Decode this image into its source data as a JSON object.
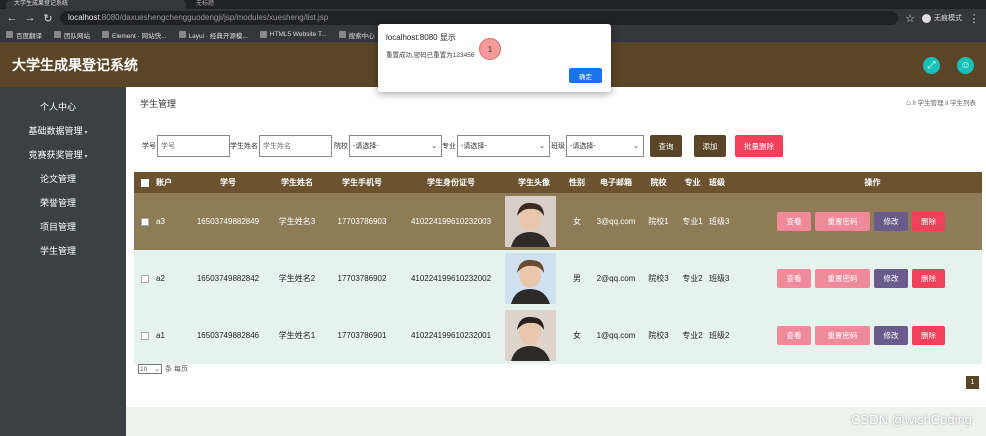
{
  "browser": {
    "tab_active": "大学生成果登记系统",
    "tab_inactive": "无标题",
    "url_host": "localhost",
    "url_rest": ":8080/daxueshengchengguodengji/jsp/modules/xuesheng/list.jsp",
    "incognito_label": "无痕模式",
    "bookmarks": [
      "百度翻译",
      "团队网站",
      "Element · 网站快...",
      "Layui · 经典开源模...",
      "HTML5 Website T...",
      "搜索中心"
    ]
  },
  "app": {
    "title": "大学生成果登记系统"
  },
  "sidebar": {
    "items": [
      {
        "label": "个人中心",
        "has_caret": false
      },
      {
        "label": "基础数据管理",
        "has_caret": true
      },
      {
        "label": "竞赛获奖管理",
        "has_caret": true
      },
      {
        "label": "论文管理",
        "has_caret": false
      },
      {
        "label": "荣誉管理",
        "has_caret": false
      },
      {
        "label": "项目管理",
        "has_caret": false
      },
      {
        "label": "学生管理",
        "has_caret": false
      }
    ]
  },
  "page": {
    "title": "学生管理",
    "breadcrumb": "ll 学生管理 ll 学生列表"
  },
  "filters": {
    "student_no_label": "学号",
    "student_no_placeholder": "学号",
    "student_name_label": "学生姓名",
    "student_name_placeholder": "学生姓名",
    "college_label": "院校",
    "college_value": "-请选择-",
    "major_label": "专业",
    "major_value": "-请选择-",
    "class_label": "班级",
    "class_value": "-请选择-",
    "query_button": "查询",
    "add_button": "添加",
    "batch_delete_button": "批量删除"
  },
  "table": {
    "headers": {
      "account": "账户",
      "student_no": "学号",
      "name": "学生姓名",
      "phone": "学生手机号",
      "id_card": "学生身份证号",
      "avatar": "学生头像",
      "gender": "性别",
      "email": "电子邮箱",
      "college": "院校",
      "major": "专业",
      "class": "班级",
      "ops": "操作"
    },
    "rows": [
      {
        "account": "a3",
        "student_no": "16503749882849",
        "name": "学生姓名3",
        "phone": "17703786903",
        "id_card": "410224199610232003",
        "gender": "女",
        "email": "3@qq.com",
        "college": "院校1",
        "major": "专业1",
        "class": "班级3"
      },
      {
        "account": "a2",
        "student_no": "16503749882842",
        "name": "学生姓名2",
        "phone": "17703786902",
        "id_card": "410224199610232002",
        "gender": "男",
        "email": "2@qq.com",
        "college": "院校3",
        "major": "专业2",
        "class": "班级3"
      },
      {
        "account": "a1",
        "student_no": "16503749882846",
        "name": "学生姓名1",
        "phone": "17703786901",
        "id_card": "410224199610232001",
        "gender": "女",
        "email": "1@qq.com",
        "college": "院校3",
        "major": "专业2",
        "class": "班级2"
      }
    ],
    "op_labels": {
      "view": "查看",
      "reset": "重置密码",
      "edit": "修改",
      "delete": "删除"
    }
  },
  "pager": {
    "page_size": "10",
    "per_page_label": "条 每页",
    "current_page": "1"
  },
  "alert": {
    "title": "localhost:8080 显示",
    "message": "重置成功,密码已重置为123456",
    "ok_button": "确定"
  },
  "annotation_badge": "1",
  "watermark": "CSDN @wishCoding",
  "colors": {
    "header_brown": "#5a4527",
    "sidebar_bg": "#3b4043",
    "accent_teal": "#16c2b8",
    "danger": "#f0405a"
  }
}
